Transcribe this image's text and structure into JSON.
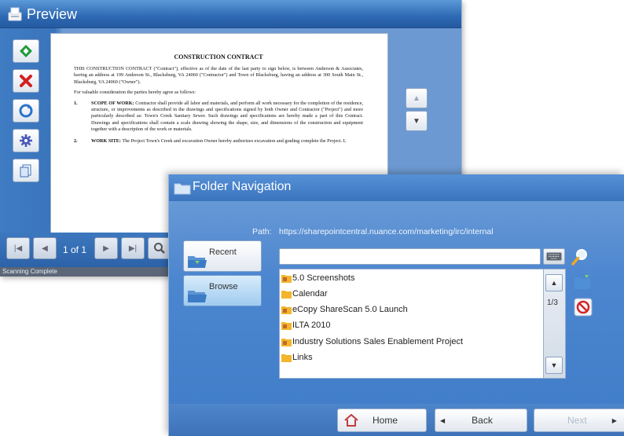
{
  "preview": {
    "title": "Preview",
    "side_buttons": [
      {
        "name": "approve-icon",
        "color": "#1f9b3a"
      },
      {
        "name": "delete-icon",
        "color": "#d32020"
      },
      {
        "name": "refresh-icon",
        "color": "#2a74c9"
      },
      {
        "name": "settings-icon",
        "color": "#4a58b8"
      },
      {
        "name": "page-icon",
        "color": "#3b6fb6"
      }
    ],
    "document": {
      "title": "CONSTRUCTION CONTRACT",
      "intro": "THIS CONSTRUCTION CONTRACT (\"Contract\"), effective as of the date of the last party to sign below, is between Anderson & Associates, having an address at 199 Anderson St., Blacksburg, VA 24060 (\"Contractor\") and Town of Blacksburg, having an address at 300 South Main St., Blacksburg, VA 24060 (\"Owner\").",
      "consideration": "For valuable consideration the parties hereby agree as follows:",
      "items": [
        {
          "num": "1.",
          "heading": "SCOPE OF WORK:",
          "text": "Contractor shall provide all labor and materials, and perform all work necessary for the completion of the residence, structure, or improvements as described in the drawings and specifications signed by both Owner and Contractor (\"Project\") and more particularly described as: Town's Creek Sanitary Sewer. Such drawings and specifications are hereby made a part of this Contract. Drawings and specifications shall contain a scale drawing showing the shape, size, and dimensions of the construction and equipment together with a description of the work or materials."
        },
        {
          "num": "2.",
          "heading": "WORK SITE:",
          "text": "The Project Town's Creek and excavation Owner hereby authorizes excavation and grading complete the Project. L"
        }
      ]
    },
    "page_indicator": "1 of 1",
    "status": "Scanning Complete"
  },
  "folder_nav": {
    "title": "Folder Navigation",
    "path_label": "Path:",
    "path_value": "https://sharepointcentral.nuance.com/marketing/irc/internal",
    "tabs": [
      {
        "label": "Recent",
        "active": false
      },
      {
        "label": "Browse",
        "active": true
      }
    ],
    "search_value": "",
    "items": [
      {
        "label": "5.0 Screenshots"
      },
      {
        "label": "Calendar"
      },
      {
        "label": "eCopy ShareScan 5.0 Launch"
      },
      {
        "label": "ILTA 2010"
      },
      {
        "label": "Industry Solutions Sales Enablement Project"
      },
      {
        "label": "Links"
      }
    ],
    "page_indicator": "1/3",
    "footer": {
      "home": "Home",
      "back": "Back",
      "next": "Next"
    }
  },
  "colors": {
    "window_blue": "#2f6cb5",
    "folder_icon": "#f2b52c",
    "cancel_red": "#d42525"
  }
}
